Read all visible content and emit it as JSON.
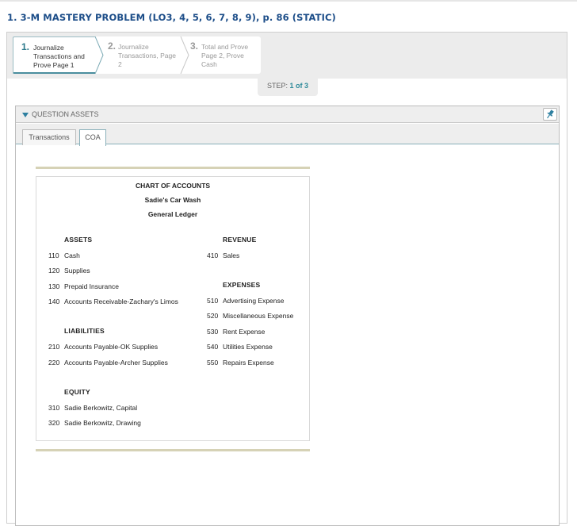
{
  "problem": {
    "title": "1. 3-M MASTERY PROBLEM (LO3, 4, 5, 6, 7, 8, 9), p. 86 (STATIC)"
  },
  "steps": [
    {
      "num": "1.",
      "label": "Journalize Transactions and Prove Page 1"
    },
    {
      "num": "2.",
      "label": "Journalize Transactions, Page 2"
    },
    {
      "num": "3.",
      "label": "Total and Prove Page 2, Prove Cash"
    }
  ],
  "step_indicator": {
    "prefix": "STEP:",
    "current": "1 of 3"
  },
  "question_assets": {
    "header": "QUESTION ASSETS",
    "pin_icon": "pin-icon"
  },
  "tabs": [
    {
      "label": "Transactions"
    },
    {
      "label": "COA"
    }
  ],
  "coa": {
    "title": "CHART OF ACCOUNTS",
    "company": "Sadie's Car Wash",
    "ledger": "General Ledger",
    "assets": {
      "heading": "ASSETS",
      "accounts": [
        {
          "num": "110",
          "name": "Cash"
        },
        {
          "num": "120",
          "name": "Supplies"
        },
        {
          "num": "130",
          "name": "Prepaid Insurance"
        },
        {
          "num": "140",
          "name": "Accounts Receivable-Zachary's Limos"
        }
      ]
    },
    "liabilities": {
      "heading": "LIABILITIES",
      "accounts": [
        {
          "num": "210",
          "name": "Accounts Payable-OK Supplies"
        },
        {
          "num": "220",
          "name": "Accounts Payable-Archer Supplies"
        }
      ]
    },
    "equity": {
      "heading": "EQUITY",
      "accounts": [
        {
          "num": "310",
          "name": "Sadie Berkowitz, Capital"
        },
        {
          "num": "320",
          "name": "Sadie Berkowitz, Drawing"
        }
      ]
    },
    "revenue": {
      "heading": "REVENUE",
      "accounts": [
        {
          "num": "410",
          "name": "Sales"
        }
      ]
    },
    "expenses": {
      "heading": "EXPENSES",
      "accounts": [
        {
          "num": "510",
          "name": "Advertising Expense"
        },
        {
          "num": "520",
          "name": "Miscellaneous Expense"
        },
        {
          "num": "530",
          "name": "Rent Expense"
        },
        {
          "num": "540",
          "name": "Utilities Expense"
        },
        {
          "num": "550",
          "name": "Repairs Expense"
        }
      ]
    }
  }
}
